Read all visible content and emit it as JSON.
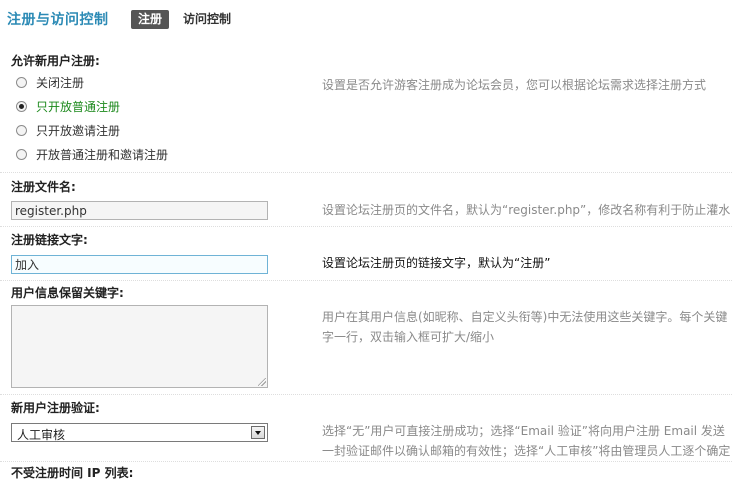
{
  "header": {
    "title": "注册与访问控制",
    "tabs": [
      {
        "label": "注册",
        "active": true
      },
      {
        "label": "访问控制",
        "active": false
      }
    ]
  },
  "sections": {
    "allow_register": {
      "label": "允许新用户注册:",
      "options": [
        {
          "label": "关闭注册",
          "checked": false
        },
        {
          "label": "只开放普通注册",
          "checked": true
        },
        {
          "label": "只开放邀请注册",
          "checked": false
        },
        {
          "label": "开放普通注册和邀请注册",
          "checked": false
        }
      ],
      "desc": "设置是否允许游客注册成为论坛会员，您可以根据论坛需求选择注册方式"
    },
    "register_file": {
      "label": "注册文件名:",
      "value": "register.php",
      "desc": "设置论坛注册页的文件名，默认为“register.php”，修改名称有利于防止灌水"
    },
    "register_link": {
      "label": "注册链接文字:",
      "value": "加入",
      "desc": "设置论坛注册页的链接文字，默认为“注册”"
    },
    "reserved_keywords": {
      "label": "用户信息保留关键字:",
      "value": "",
      "desc": "用户在其用户信息(如昵称、自定义头衔等)中无法使用这些关键字。每个关键字一行，双击输入框可扩大/缩小"
    },
    "register_verify": {
      "label": "新用户注册验证:",
      "selected": "人工审核",
      "desc": "选择“无”用户可直接注册成功；选择“Email 验证”将向用户注册 Email 发送一封验证邮件以确认邮箱的有效性；选择“人工审核”将由管理员人工逐个确定是否允许新用户注册"
    },
    "ip_limit": {
      "label": "不受注册时间 IP 列表:"
    }
  },
  "colors": {
    "title_blue": "#2b8ab5",
    "tab_active_bg": "#555555",
    "checked_green": "#1d8a1d",
    "focus_border": "#6fb3d6"
  }
}
